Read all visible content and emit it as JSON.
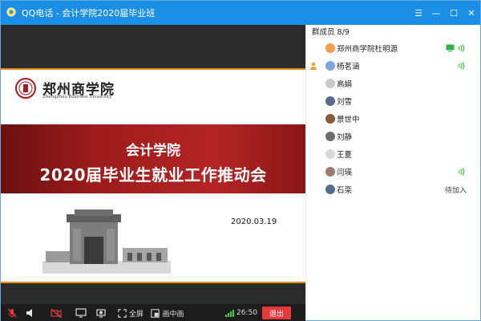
{
  "window": {
    "title": "QQ电话 - 会计学院2020届毕业班",
    "controls": [
      "☰",
      "—",
      "☐",
      "✕"
    ]
  },
  "colors": {
    "titlebar": "#1b8fe6",
    "accent_orange": "#e58a1f",
    "banner_red": "#b42525",
    "speaking_green": "#3ed13e",
    "exit_red": "#e5393d"
  },
  "slide": {
    "school_name_cn": "郑州商学院",
    "school_name_en": "Zhengzhou Business University",
    "banner_line1": "会计学院",
    "banner_line2": "2020届毕业生就业工作推动会",
    "date": "2020.03.19"
  },
  "toolbar": {
    "mic_icon": "mic-muted-icon",
    "speaker_icon": "speaker-icon",
    "camera_icon": "camera-off-icon",
    "share_icon": "share-screen-icon",
    "record_icon": "record-icon",
    "fullscreen_label": "全屏",
    "pip_label": "画中画",
    "time": "26:50",
    "exit_label": "退出"
  },
  "members": {
    "header": "群成员 8/9",
    "list": [
      {
        "name": "郑州商学院杜明源",
        "admin": false,
        "speaking": true,
        "sharing": true,
        "status": ""
      },
      {
        "name": "杨茗涵",
        "admin": true,
        "speaking": true,
        "sharing": false,
        "status": ""
      },
      {
        "name": "高娟",
        "admin": false,
        "speaking": false,
        "sharing": false,
        "status": ""
      },
      {
        "name": "刘雪",
        "admin": false,
        "speaking": false,
        "sharing": false,
        "status": ""
      },
      {
        "name": "景世中",
        "admin": false,
        "speaking": false,
        "sharing": false,
        "status": ""
      },
      {
        "name": "刘静",
        "admin": false,
        "speaking": false,
        "sharing": false,
        "status": ""
      },
      {
        "name": "王夏",
        "admin": false,
        "speaking": false,
        "sharing": false,
        "status": ""
      },
      {
        "name": "闫瑛",
        "admin": false,
        "speaking": true,
        "sharing": false,
        "status": ""
      },
      {
        "name": "石栾",
        "admin": false,
        "speaking": false,
        "sharing": false,
        "status": "待加入"
      }
    ]
  }
}
